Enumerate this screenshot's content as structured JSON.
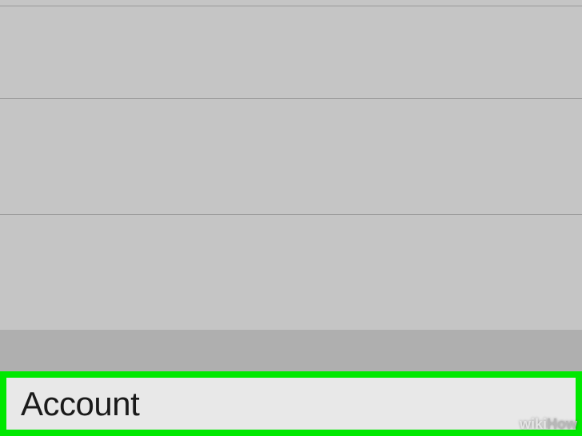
{
  "rows": {
    "highlighted": {
      "label": "Account"
    }
  },
  "watermark": {
    "part1": "wiki",
    "part2": "How"
  },
  "highlight_color": "#00e800"
}
